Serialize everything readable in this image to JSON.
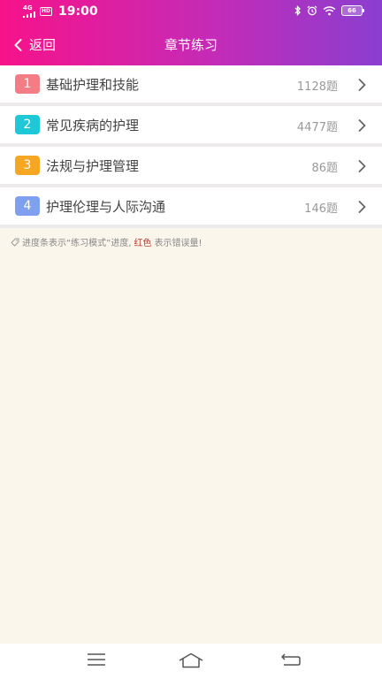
{
  "statusbar": {
    "network": "4G",
    "hd": "HD",
    "time": "19:00",
    "battery": "66"
  },
  "navbar": {
    "back_label": "返回",
    "title": "章节练习"
  },
  "chapters": [
    {
      "num": "1",
      "name": "基础护理和技能",
      "count": "1128题",
      "color": "#f47c84"
    },
    {
      "num": "2",
      "name": "常见疾病的护理",
      "count": "4477题",
      "color": "#1fc8d6"
    },
    {
      "num": "3",
      "name": "法规与护理管理",
      "count": "86题",
      "color": "#f5a623"
    },
    {
      "num": "4",
      "name": "护理伦理与人际沟通",
      "count": "146题",
      "color": "#7fa0ee"
    }
  ],
  "hint": {
    "part1": "进度条表示“练习模式”进度,",
    "red": "红色",
    "part2": "表示错误量!"
  }
}
